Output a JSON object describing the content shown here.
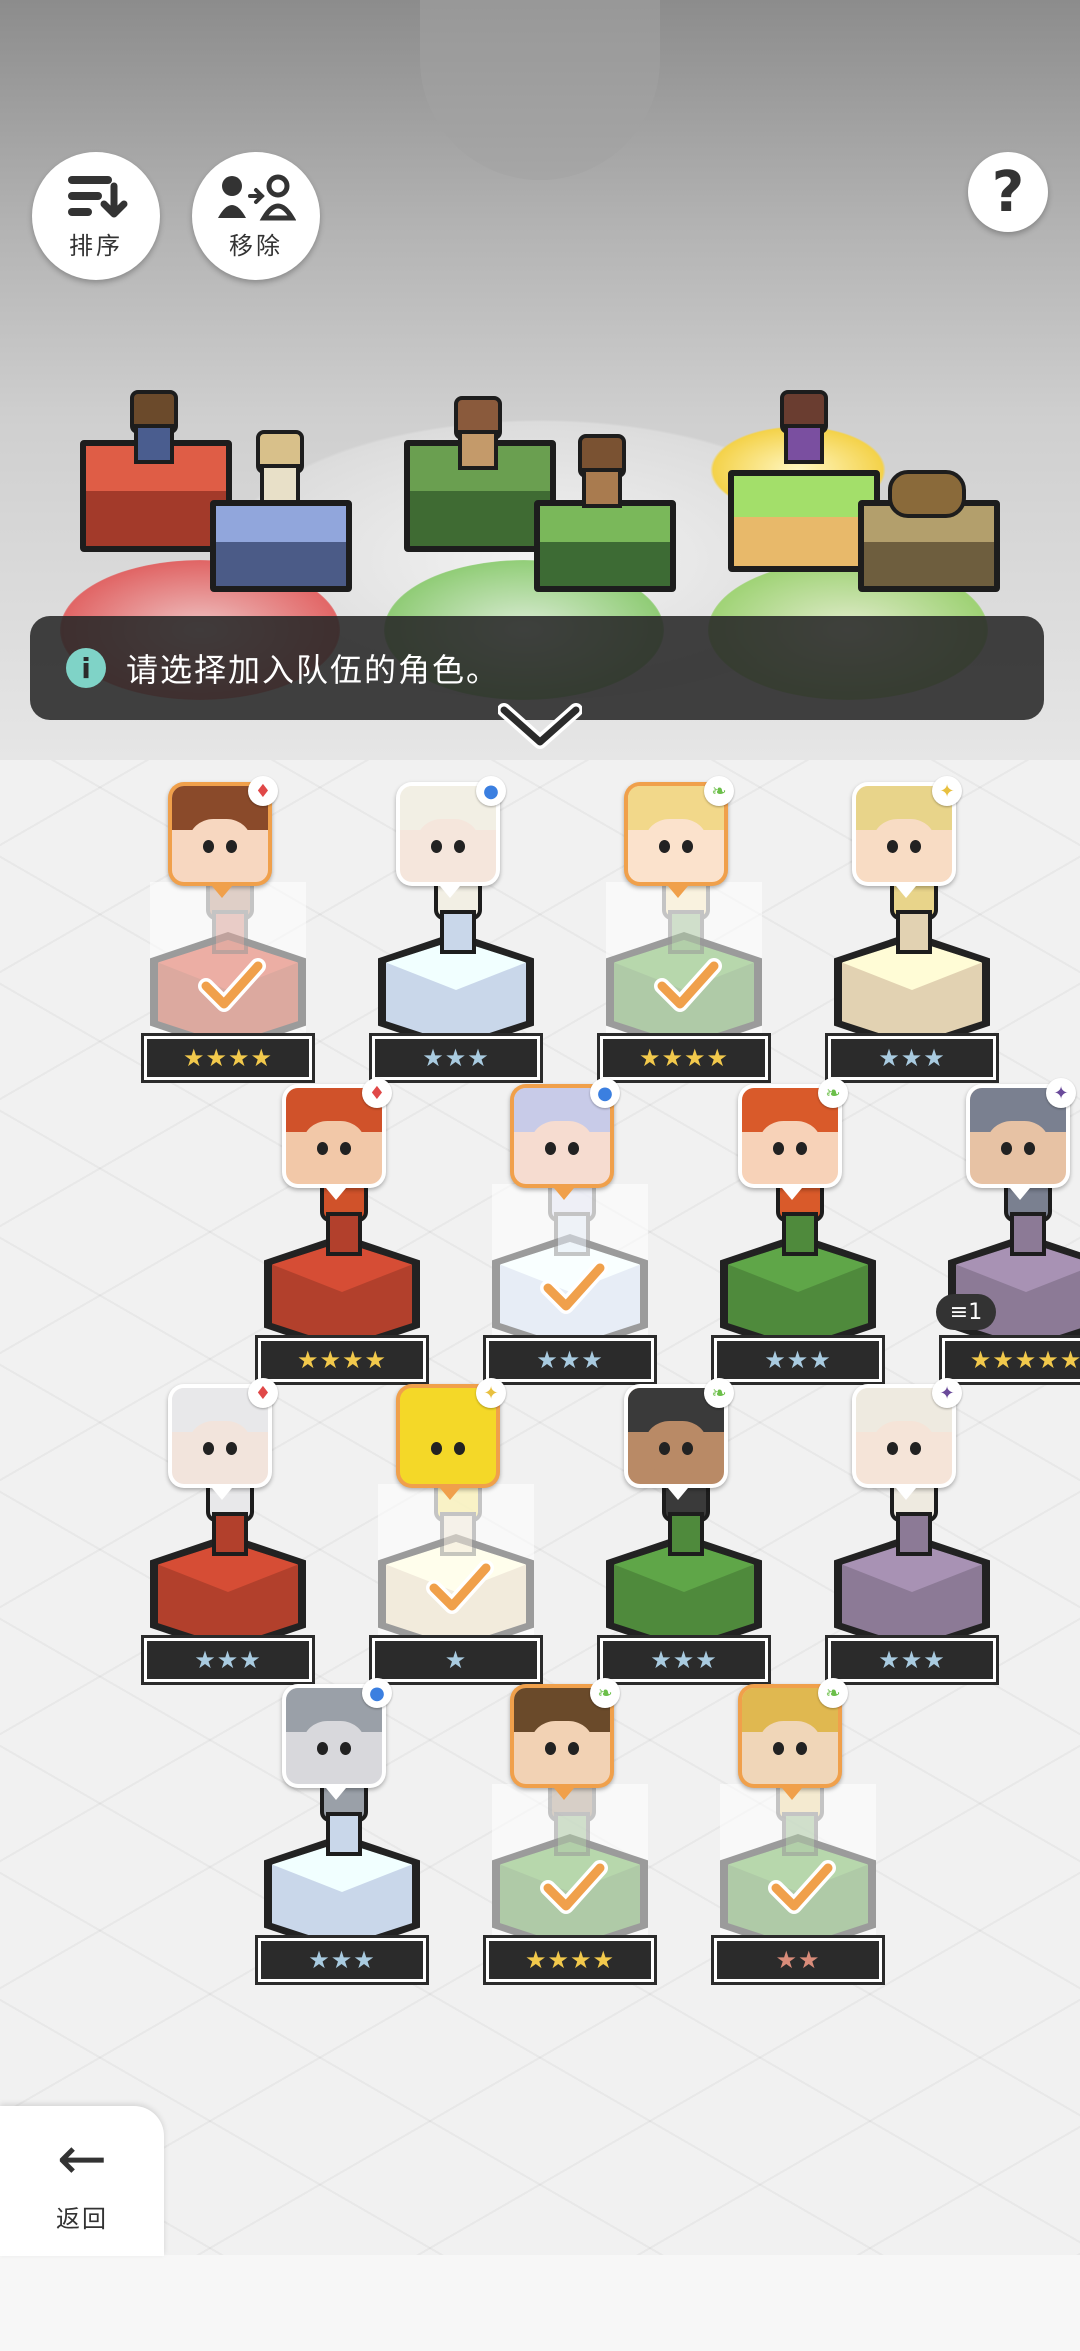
{
  "toolbar": {
    "sort_label": "排序",
    "remove_label": "移除",
    "help_label": "?"
  },
  "notice": {
    "text": "请选择加入队伍的角色。"
  },
  "characters": [
    {
      "element": "fire",
      "stars": 4,
      "star_text": "★★★★",
      "selected": true,
      "count_badge": ""
    },
    {
      "element": "water",
      "stars": 3,
      "star_text": "★★★",
      "selected": false,
      "count_badge": ""
    },
    {
      "element": "earth",
      "stars": 4,
      "star_text": "★★★★",
      "selected": true,
      "count_badge": ""
    },
    {
      "element": "light",
      "stars": 3,
      "star_text": "★★★",
      "selected": false,
      "count_badge": ""
    },
    {
      "element": "fire",
      "stars": 4,
      "star_text": "★★★★",
      "selected": false,
      "count_badge": ""
    },
    {
      "element": "water",
      "stars": 3,
      "star_text": "★★★",
      "selected": true,
      "count_badge": ""
    },
    {
      "element": "earth",
      "stars": 3,
      "star_text": "★★★",
      "selected": false,
      "count_badge": ""
    },
    {
      "element": "dark",
      "stars": 5,
      "star_text": "★★★★★",
      "selected": false,
      "count_badge": "1"
    },
    {
      "element": "fire",
      "stars": 3,
      "star_text": "★★★",
      "selected": false,
      "count_badge": ""
    },
    {
      "element": "light",
      "stars": 1,
      "star_text": "★",
      "selected": true,
      "count_badge": ""
    },
    {
      "element": "earth",
      "stars": 3,
      "star_text": "★★★",
      "selected": false,
      "count_badge": ""
    },
    {
      "element": "dark",
      "stars": 3,
      "star_text": "★★★",
      "selected": false,
      "count_badge": ""
    },
    {
      "element": "water",
      "stars": 3,
      "star_text": "★★★",
      "selected": false,
      "count_badge": ""
    },
    {
      "element": "earth",
      "stars": 4,
      "star_text": "★★★★",
      "selected": true,
      "count_badge": ""
    },
    {
      "element": "earth",
      "stars": 2,
      "star_text": "★★",
      "selected": true,
      "count_badge": ""
    }
  ],
  "navigation": {
    "back_label": "返回"
  }
}
